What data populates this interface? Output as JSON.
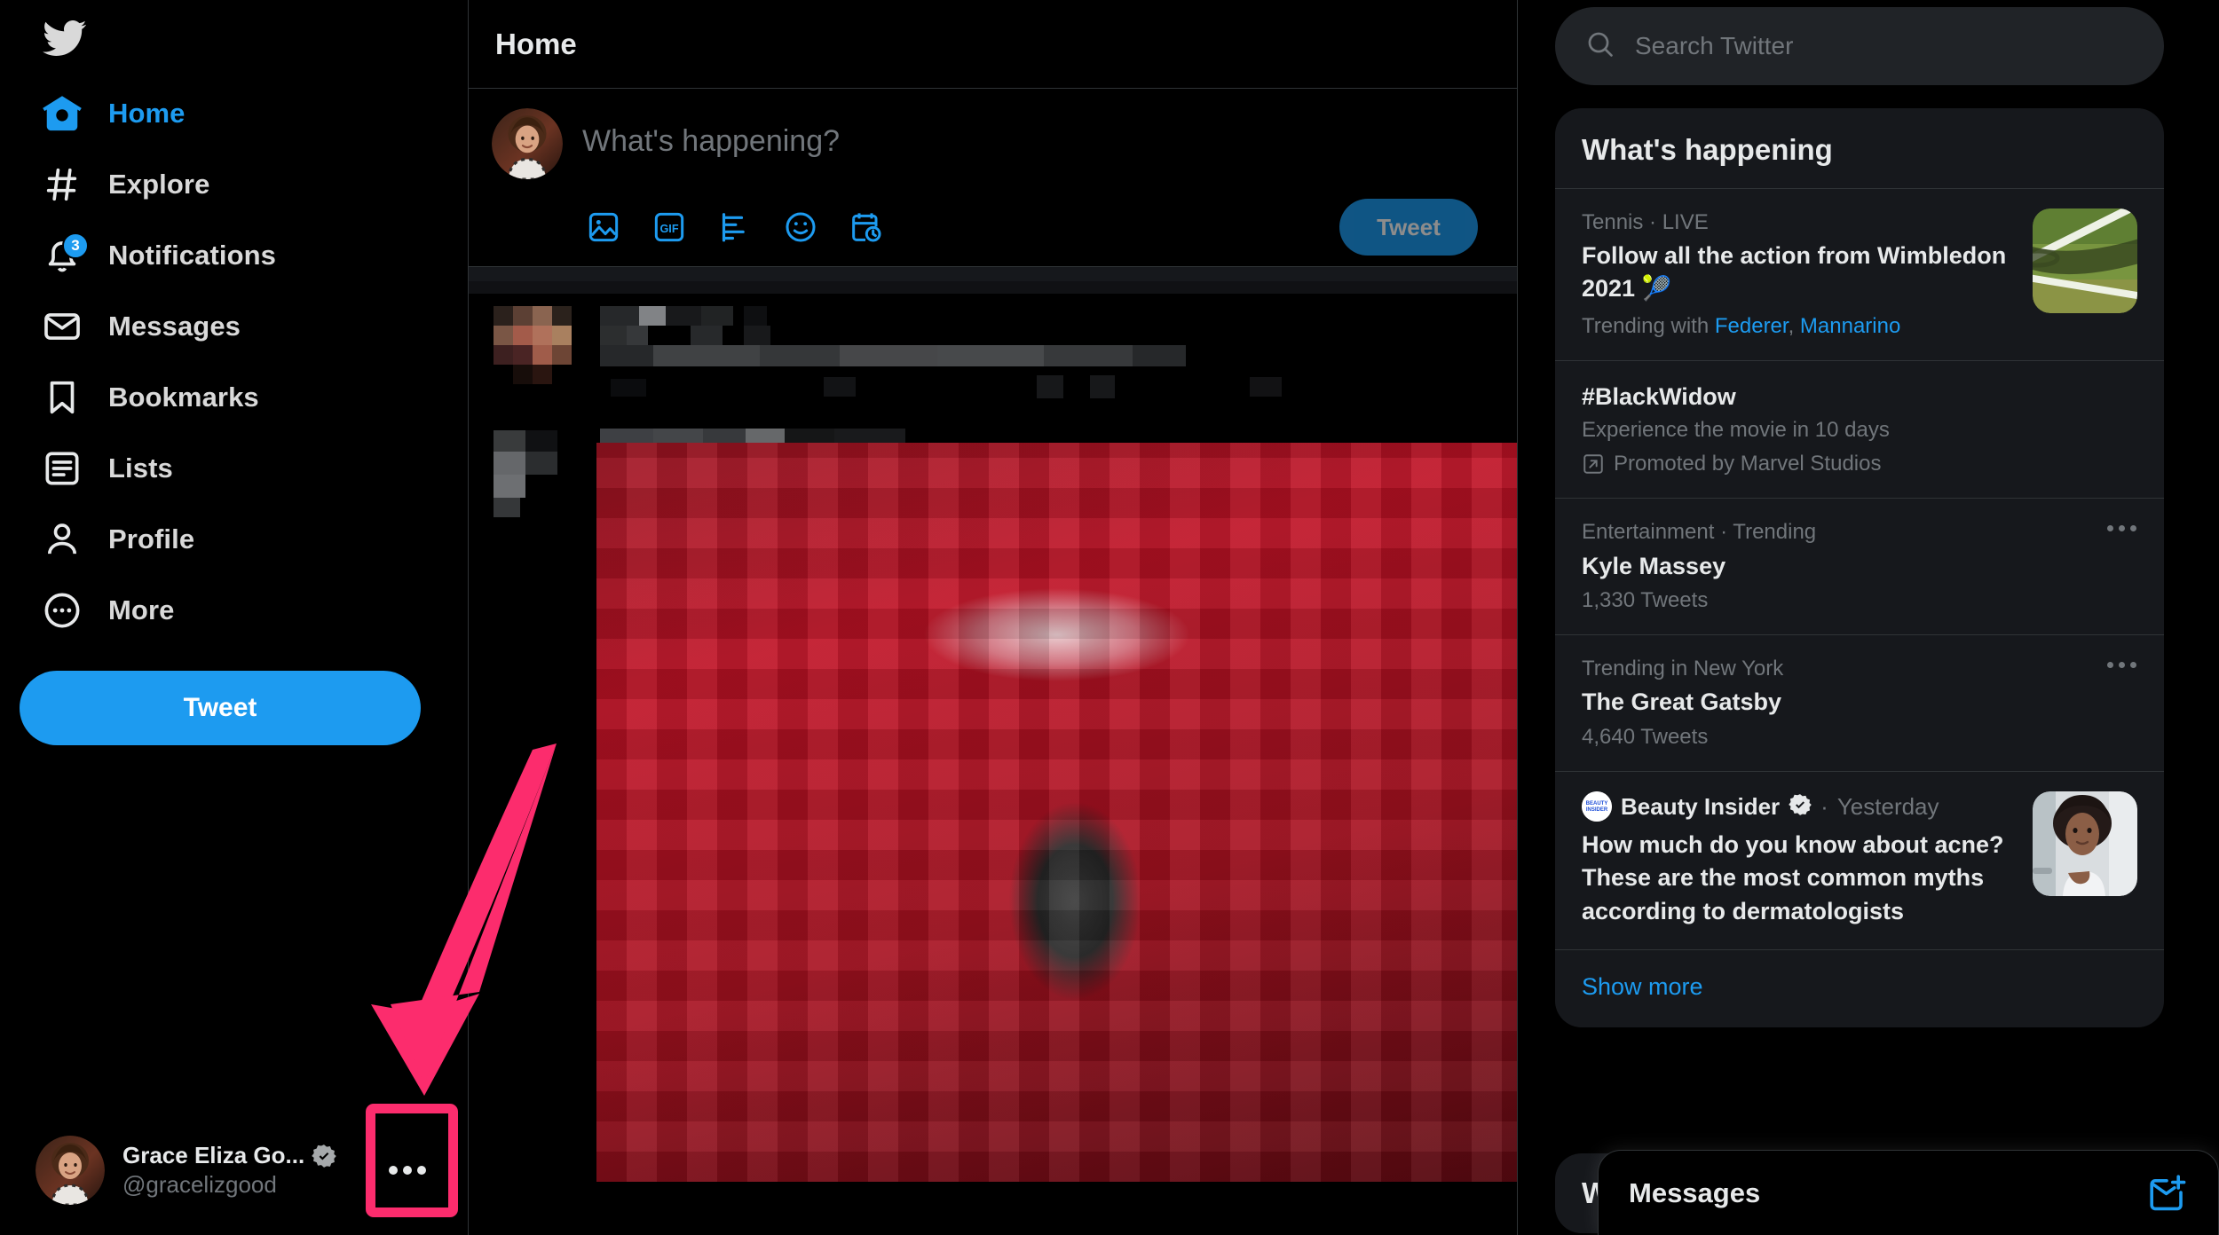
{
  "app": {
    "name": "Twitter",
    "logo_icon": "twitter-bird-icon"
  },
  "sidebar": {
    "items": [
      {
        "label": "Home",
        "icon": "home-icon",
        "active": true,
        "badge": null
      },
      {
        "label": "Explore",
        "icon": "hashtag-icon",
        "active": false,
        "badge": null
      },
      {
        "label": "Notifications",
        "icon": "bell-icon",
        "active": false,
        "badge": "3"
      },
      {
        "label": "Messages",
        "icon": "envelope-icon",
        "active": false,
        "badge": null
      },
      {
        "label": "Bookmarks",
        "icon": "bookmark-icon",
        "active": false,
        "badge": null
      },
      {
        "label": "Lists",
        "icon": "list-icon",
        "active": false,
        "badge": null
      },
      {
        "label": "Profile",
        "icon": "person-icon",
        "active": false,
        "badge": null
      },
      {
        "label": "More",
        "icon": "more-circle-icon",
        "active": false,
        "badge": null
      }
    ],
    "tweet_button": "Tweet",
    "account": {
      "display_name": "Grace Eliza Go...",
      "handle": "@gracelizgood",
      "verified": true,
      "avatar_icon": "user-avatar",
      "more_button_icon": "ellipsis-icon"
    }
  },
  "main": {
    "header_title": "Home",
    "composer": {
      "placeholder": "What's happening?",
      "avatar_icon": "user-avatar",
      "tools": [
        {
          "name": "media-icon",
          "label": "Media"
        },
        {
          "name": "gif-icon",
          "label": "GIF"
        },
        {
          "name": "poll-icon",
          "label": "Poll"
        },
        {
          "name": "emoji-icon",
          "label": "Emoji"
        },
        {
          "name": "schedule-icon",
          "label": "Schedule"
        }
      ],
      "tweet_button": "Tweet"
    },
    "feed_note": "censored-pixelated-timeline"
  },
  "right": {
    "search": {
      "placeholder": "Search Twitter",
      "icon": "search-icon"
    },
    "whats_happening": {
      "title": "What's happening",
      "items": [
        {
          "kind": "live",
          "meta": "Tennis · LIVE",
          "name": "Follow all the action from Wimbledon 2021 🎾",
          "trending_with_prefix": "Trending with",
          "trending_with": [
            "Federer",
            "Mannarino"
          ],
          "thumb_icon": "tennis-court-thumbnail",
          "has_dots": false
        },
        {
          "kind": "promoted",
          "meta": null,
          "name": "#BlackWidow",
          "sub": "Experience the movie in 10 days",
          "promo_icon": "promoted-arrow-icon",
          "promo_text": "Promoted by Marvel Studios",
          "has_dots": false
        },
        {
          "kind": "trend",
          "meta": "Entertainment · Trending",
          "name": "Kyle Massey",
          "count": "1,330 Tweets",
          "has_dots": true
        },
        {
          "kind": "trend",
          "meta": "Trending in New York",
          "name": "The Great Gatsby",
          "count": "4,640 Tweets",
          "has_dots": true
        },
        {
          "kind": "news",
          "source": "Beauty Insider",
          "source_verified": true,
          "time": "Yesterday",
          "separator": "·",
          "name": "How much do you know about acne? These are the most common myths according to dermatologists",
          "thumb_icon": "acne-article-thumbnail",
          "has_dots": false
        }
      ],
      "show_more": "Show more"
    },
    "who_to_follow": {
      "title": "Who to follow"
    },
    "messages_dock": {
      "title": "Messages",
      "compose_icon": "new-message-icon"
    }
  },
  "annotations": {
    "arrow": {
      "icon": "pointer-arrow",
      "color": "#fc2c6d",
      "points_to": "account-more-button"
    },
    "highlight_box": {
      "color": "#fc2c6d",
      "target": "account-more-button"
    }
  },
  "colors": {
    "brand_blue": "#1d9bf0",
    "background": "#000000",
    "card": "#16181c",
    "search_field": "#202327",
    "border": "#2f3336",
    "text_primary": "#e7e9ea",
    "text_secondary": "#71767b",
    "annotation_pink": "#fc2c6d"
  }
}
